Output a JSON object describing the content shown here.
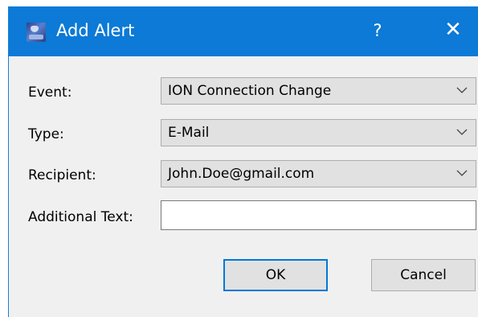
{
  "window": {
    "title": "Add Alert",
    "help_label": "?",
    "close_label": "✕",
    "titlebar_color": "#0c7ad6",
    "icon": "app-satellite-icon"
  },
  "form": {
    "event": {
      "label": "Event:",
      "value": "ION Connection Change"
    },
    "type": {
      "label": "Type:",
      "value": "E-Mail"
    },
    "recipient": {
      "label": "Recipient:",
      "value": "John.Doe@gmail.com"
    },
    "additional_text": {
      "label": "Additional Text:",
      "value": ""
    }
  },
  "buttons": {
    "ok_label": "OK",
    "cancel_label": "Cancel"
  }
}
